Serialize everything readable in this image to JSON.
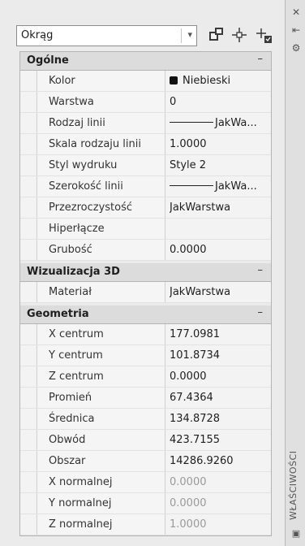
{
  "selector": {
    "value": "Okrąg"
  },
  "side": {
    "label": "WŁAŚCIWOŚCI"
  },
  "groups": [
    {
      "name": "Ogólne",
      "toggle": "–",
      "rows": [
        {
          "key": "Kolor",
          "value": "Niebieski",
          "swatch": "#111111"
        },
        {
          "key": "Warstwa",
          "value": "0"
        },
        {
          "key": "Rodzaj linii",
          "value": "JakWa..."
        },
        {
          "key": "Skala rodzaju linii",
          "value": "1.0000"
        },
        {
          "key": "Styl wydruku",
          "value": "Style 2"
        },
        {
          "key": "Szerokość linii",
          "value": "JakWa..."
        },
        {
          "key": "Przezroczystość",
          "value": "JakWarstwa"
        },
        {
          "key": "Hiperłącze",
          "value": ""
        },
        {
          "key": "Grubość",
          "value": "0.0000"
        }
      ]
    },
    {
      "name": "Wizualizacja 3D",
      "toggle": "–",
      "rows": [
        {
          "key": "Materiał",
          "value": "JakWarstwa"
        }
      ]
    },
    {
      "name": "Geometria",
      "toggle": "–",
      "rows": [
        {
          "key": "X centrum",
          "value": "177.0981"
        },
        {
          "key": "Y centrum",
          "value": "101.8734"
        },
        {
          "key": "Z centrum",
          "value": "0.0000"
        },
        {
          "key": "Promień",
          "value": "67.4364"
        },
        {
          "key": "Średnica",
          "value": "134.8728"
        },
        {
          "key": "Obwód",
          "value": "423.7155"
        },
        {
          "key": "Obszar",
          "value": "14286.9260"
        },
        {
          "key": "X normalnej",
          "value": "0.0000",
          "dim": true
        },
        {
          "key": "Y normalnej",
          "value": "0.0000",
          "dim": true
        },
        {
          "key": "Z normalnej",
          "value": "1.0000",
          "dim": true
        }
      ]
    }
  ]
}
